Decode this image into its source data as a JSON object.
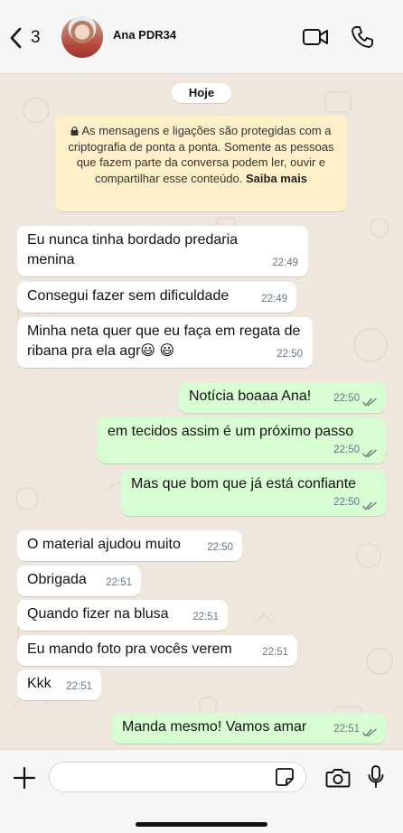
{
  "header": {
    "back_count": "3",
    "contact_name": "Ana PDR34"
  },
  "chat": {
    "date_label": "Hoje",
    "encryption_notice": "As mensagens e ligações são protegidas com a criptografia de ponta a ponta. Somente as pessoas que fazem parte da conversa podem ler, ouvir e compartilhar esse conteúdo.",
    "encryption_link": "Saiba mais",
    "messages": [
      {
        "direction": "in",
        "text": "Eu nunca tinha bordado predaria menina",
        "time": "22:49"
      },
      {
        "direction": "in",
        "text": "Consegui fazer sem dificuldade",
        "time": "22:49"
      },
      {
        "direction": "in",
        "text": "Minha neta quer que eu faça em regata de ribana pra ela agr😃 😃",
        "time": "22:50"
      },
      {
        "direction": "out",
        "text": "Notícia boaaa Ana!",
        "time": "22:50",
        "status": "read"
      },
      {
        "direction": "out",
        "text": "em tecidos assim é um próximo passo",
        "time": "22:50",
        "status": "read"
      },
      {
        "direction": "out",
        "text": "Mas que bom que já está confiante",
        "time": "22:50",
        "status": "read"
      },
      {
        "direction": "in",
        "text": "O material ajudou muito",
        "time": "22:50"
      },
      {
        "direction": "in",
        "text": "Obrigada",
        "time": "22:51"
      },
      {
        "direction": "in",
        "text": "Quando fizer na blusa",
        "time": "22:51"
      },
      {
        "direction": "in",
        "text": "Eu mando foto pra vocês verem",
        "time": "22:51"
      },
      {
        "direction": "in",
        "text": "Kkk",
        "time": "22:51"
      },
      {
        "direction": "out",
        "text": "Manda mesmo! Vamos amar",
        "time": "22:51",
        "status": "read"
      }
    ]
  },
  "composer": {
    "placeholder": ""
  },
  "colors": {
    "incoming_bubble": "#ffffff",
    "outgoing_bubble": "#d9fdd3",
    "chat_background": "#efe7dd",
    "notice_background": "#fdf0c9",
    "read_ticks": "#667781"
  },
  "icons": [
    "chevron-left-icon",
    "video-camera-icon",
    "phone-icon",
    "lock-icon",
    "plus-icon",
    "sticker-icon",
    "camera-icon",
    "microphone-icon",
    "double-check-icon"
  ]
}
